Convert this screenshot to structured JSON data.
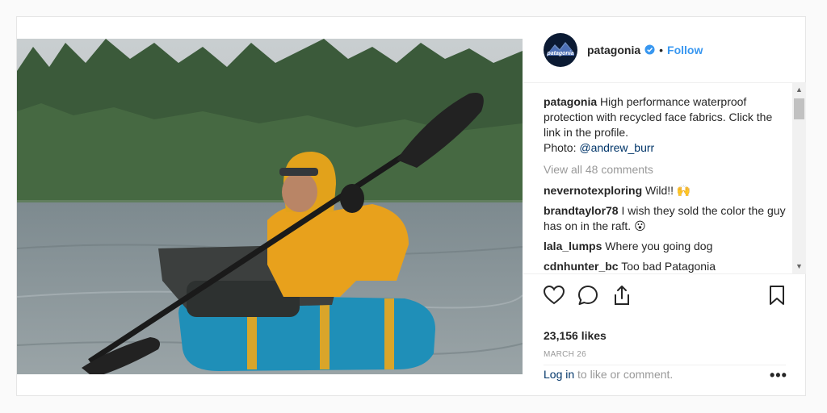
{
  "profile": {
    "handle": "patagonia",
    "separator": "•",
    "follow_label": "Follow",
    "avatar_text": "patagonia"
  },
  "caption": {
    "author": "patagonia",
    "text": "High performance waterproof protection with recycled face fabrics. Click the link in the profile.",
    "photo_prefix": "Photo:",
    "photo_credit": "@andrew_burr"
  },
  "view_all_comments": "View all 48 comments",
  "comments": [
    {
      "user": "nevernotexploring",
      "text": "Wild!! 🙌"
    },
    {
      "user": "brandtaylor78",
      "text": "I wish they sold the color the guy has on in the raft. 😮"
    },
    {
      "user": "lala_lumps",
      "text": "Where you going dog"
    },
    {
      "user": "cdnhunter_bc",
      "text": "Too bad Patagonia"
    }
  ],
  "likes": "23,156 likes",
  "date": "MARCH 26",
  "login_prompt": {
    "link": "Log in",
    "rest": " to like or comment."
  },
  "more_label": "•••",
  "icons": [
    "verified-badge-icon",
    "heart-icon",
    "comment-icon",
    "share-icon",
    "bookmark-icon",
    "scroll-up-icon",
    "scroll-down-icon",
    "more-options-icon"
  ],
  "colors": {
    "accent": "#3897f0",
    "link": "#003569",
    "muted": "#999999",
    "raft": "#1f8fb8",
    "jacket": "#e8a11c"
  }
}
